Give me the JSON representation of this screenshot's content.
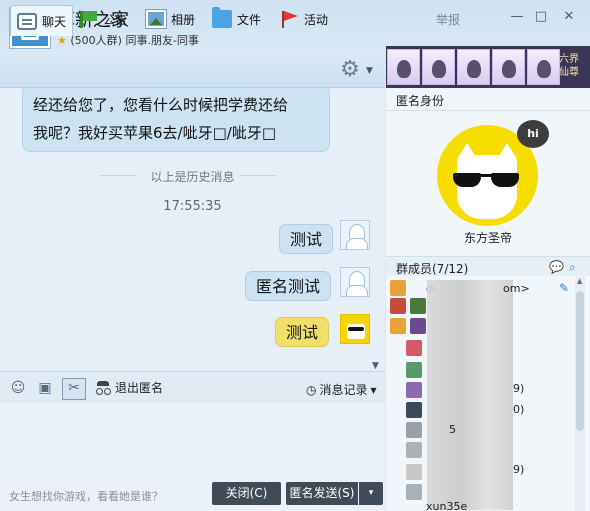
{
  "window": {
    "group_name": "革新之家",
    "group_meta": "(500人群) 同事.朋友-同事",
    "report_label": "举报",
    "minimize_glyph": "—",
    "maximize_glyph": "□",
    "close_glyph": "✕"
  },
  "tabs": [
    {
      "label": "聊天",
      "icon": "chat-icon"
    },
    {
      "label": "公告",
      "icon": "announcement-icon"
    },
    {
      "label": "相册",
      "icon": "album-icon"
    },
    {
      "label": "文件",
      "icon": "folder-icon"
    },
    {
      "label": "活动",
      "icon": "activity-flag-icon"
    }
  ],
  "games": {
    "label_line1": "六界",
    "label_line2": "仙尊"
  },
  "chat": {
    "received_line1": "经还给您了，您看什么时候把学费还给",
    "received_line2": "我呢？我好买苹果6去/呲牙□/呲牙□",
    "history_divider": "以上是历史消息",
    "timestamp": "17:55:35",
    "messages": [
      {
        "text": "测试",
        "style": "blue"
      },
      {
        "text": "匿名测试",
        "style": "blue"
      },
      {
        "text": "测试",
        "style": "yellow"
      }
    ]
  },
  "input_toolbar": {
    "emoji_icon": "☺",
    "image_icon": "▣",
    "scissors_icon": "✂",
    "exit_anon_label": "退出匿名",
    "history_label": "消息记录",
    "history_caret": "▾"
  },
  "bottom": {
    "hint": "女生想找你游戏，看看她是谁？",
    "close_label": "关闭(C)",
    "send_label": "匿名发送(S)",
    "send_caret": "▾"
  },
  "right_panel": {
    "anon_title": "匿名身份",
    "hi_badge": "hi",
    "anon_name": "东方圣帝",
    "members_title": "群成员(7/12)",
    "chat_icon": "💬",
    "search_icon": "⌕",
    "edit_icon": "✎",
    "member_fragments": [
      "ф",
      "om>",
      "9)",
      "0)",
      "5",
      "9)",
      "xun35e"
    ]
  },
  "colors": {
    "accent_blue": "#2e7bc8",
    "bubble_blue": "#cde3f1",
    "bubble_yellow": "#f0e06a",
    "avatar_yellow": "#f7dc00",
    "dark_button": "#3f4b57"
  }
}
